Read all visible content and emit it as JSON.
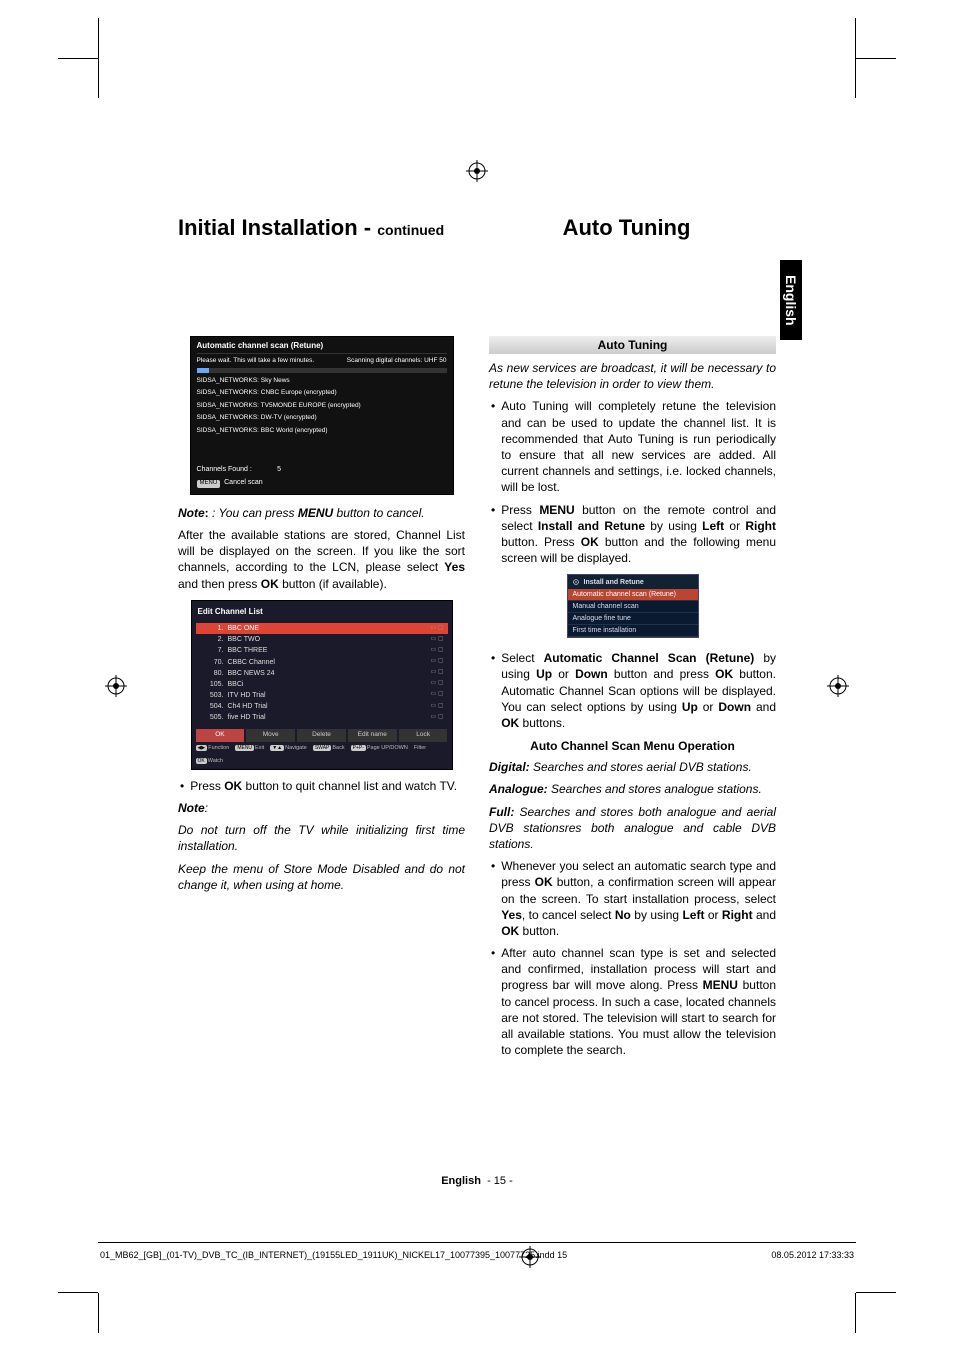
{
  "headings": {
    "left": "Initial Installation -",
    "continued": "continued",
    "right": "Auto Tuning"
  },
  "side_tab": "English",
  "osd_scan": {
    "title": "Automatic channel scan (Retune)",
    "wait": "Please wait. This will take a few minutes.",
    "scanning": "Scanning digital channels: UHF 50",
    "found_lines": [
      "SIDSA_NETWORKS: Sky News",
      "SIDSA_NETWORKS: CNBC Europe (encrypted)",
      "SIDSA_NETWORKS: TV5MONDE EUROPE (encrypted)",
      "SIDSA_NETWORKS: DW-TV (encrypted)",
      "SIDSA_NETWORKS: BBC World (encrypted)"
    ],
    "channels_found_label": "Channels Found :",
    "channels_found_value": "5",
    "cancel_key": "MENU",
    "cancel_text": "Cancel scan"
  },
  "col1": {
    "note_label": "Note",
    "note_after_scan": ": You can press ",
    "note_menu": "MENU",
    "note_tail": " button to cancel.",
    "after_stations": "After the available stations are stored, Channel List will be displayed on the screen. If you like the sort channels, according to the LCN, please select ",
    "yes": "Yes",
    "after_yes": " and then press ",
    "ok": "OK",
    "after_ok": " button (if available).",
    "press_ok_quit": "Press ",
    "press_ok_quit_tail": " button to quit channel list and watch TV.",
    "note2": "Note",
    "warn1": "Do not turn off the TV while initializing first time installation.",
    "warn2": "Keep the menu of Store Mode Disabled and do not change it, when using at home."
  },
  "osd_list": {
    "title": "Edit Channel List",
    "rows": [
      {
        "num": "1.",
        "name": "BBC ONE",
        "sel": true
      },
      {
        "num": "2.",
        "name": "BBC TWO"
      },
      {
        "num": "7.",
        "name": "BBC THREE"
      },
      {
        "num": "70.",
        "name": "CBBC Channel"
      },
      {
        "num": "80.",
        "name": "BBC NEWS 24"
      },
      {
        "num": "105.",
        "name": "BBCi"
      },
      {
        "num": "503.",
        "name": "ITV HD Trial"
      },
      {
        "num": "504.",
        "name": "Ch4 HD Trial"
      },
      {
        "num": "505.",
        "name": "five HD Trial"
      }
    ],
    "buttons": [
      "OK",
      "Move",
      "Delete",
      "Edit name",
      "Lock"
    ],
    "hints": [
      {
        "key": "◀▶",
        "label": "Function"
      },
      {
        "key": "MENU",
        "label": "Exit"
      },
      {
        "key": "▼▲",
        "label": "Navigate"
      },
      {
        "key": "SWAP",
        "label": "Back"
      },
      {
        "key": "P+P-",
        "label": "Page UP/DOWN"
      },
      {
        "key": "",
        "label": "Filter"
      },
      {
        "key": "OK",
        "label": "Watch"
      }
    ]
  },
  "col2": {
    "section_title": "Auto Tuning",
    "intro_italic": "As new services are broadcast, it will be necessary to retune the television in order to view them.",
    "b1": "Auto Tuning will completely retune the television and can be used to update the channel list. It is recommended that Auto Tuning is run periodically to ensure that all new services are added. All current channels and settings, i.e. locked channels, will be lost.",
    "b2_pre": "Press ",
    "b2_menu": "MENU",
    "b2_mid": " button on the remote control and select ",
    "b2_install": "Install and Retune",
    "b2_mid2": " by using ",
    "b2_left": "Left",
    "b2_mid3": " or ",
    "b2_right": "Right",
    "b2_mid4": " button. Press ",
    "b2_ok": "OK",
    "b2_tail": " button and the following menu screen will be displayed.",
    "menu": {
      "title": "Install and Retune",
      "items": [
        "Automatic channel scan (Retune)",
        "Manual channel scan",
        "Analogue fine tune",
        "First time installation"
      ]
    },
    "b3_pre": "Select ",
    "b3_acs": "Automatic Channel Scan (Retune)",
    "b3_mid": " by using ",
    "b3_up": "Up",
    "b3_mid2": " or ",
    "b3_down": "Down",
    "b3_mid3": " button and press ",
    "b3_ok": "OK",
    "b3_mid4": " button. Automatic Channel Scan options will be displayed. You can select options by using ",
    "b3_up2": "Up",
    "b3_mid5": " or ",
    "b3_down2": "Down",
    "b3_mid6": " and ",
    "b3_ok2": "OK",
    "b3_tail": " buttons.",
    "center_heading": "Auto Channel Scan Menu Operation",
    "digital_label": "Digital:",
    "digital_text": " Searches and stores aerial DVB stations.",
    "analogue_label": "Analogue:",
    "analogue_text": " Searches and stores analogue stations.",
    "full_label": "Full:",
    "full_text": " Searches and stores both analogue and aerial DVB stationsres both analogue and cable DVB stations.",
    "b4_pre": "Whenever you select an automatic search type and press ",
    "b4_ok": "OK",
    "b4_mid": " button, a confirmation screen will appear on the screen. To start installation process, select ",
    "b4_yes": "Yes",
    "b4_mid2": ", to cancel select ",
    "b4_no": "No",
    "b4_mid3": " by using ",
    "b4_left": "Left",
    "b4_mid4": " or ",
    "b4_right": "Right",
    "b4_mid5": " and ",
    "b4_ok2": "OK",
    "b4_tail": " button.",
    "b5_pre": "After auto channel scan type is set and selected and confirmed, installation process will start and progress bar will move along. Press ",
    "b5_menu": "MENU",
    "b5_tail": " button to cancel process. In such a case, located channels are not stored. The television will start to search for all available stations. You must allow the television to complete the search."
  },
  "footer": {
    "lang": "English",
    "page": "- 15 -"
  },
  "print_footer": {
    "file": "01_MB62_[GB]_(01-TV)_DVB_TC_(IB_INTERNET)_(19155LED_1911UK)_NICKEL17_10077395_10077725.indd   15",
    "date": "08.05.2012   17:33:33"
  }
}
